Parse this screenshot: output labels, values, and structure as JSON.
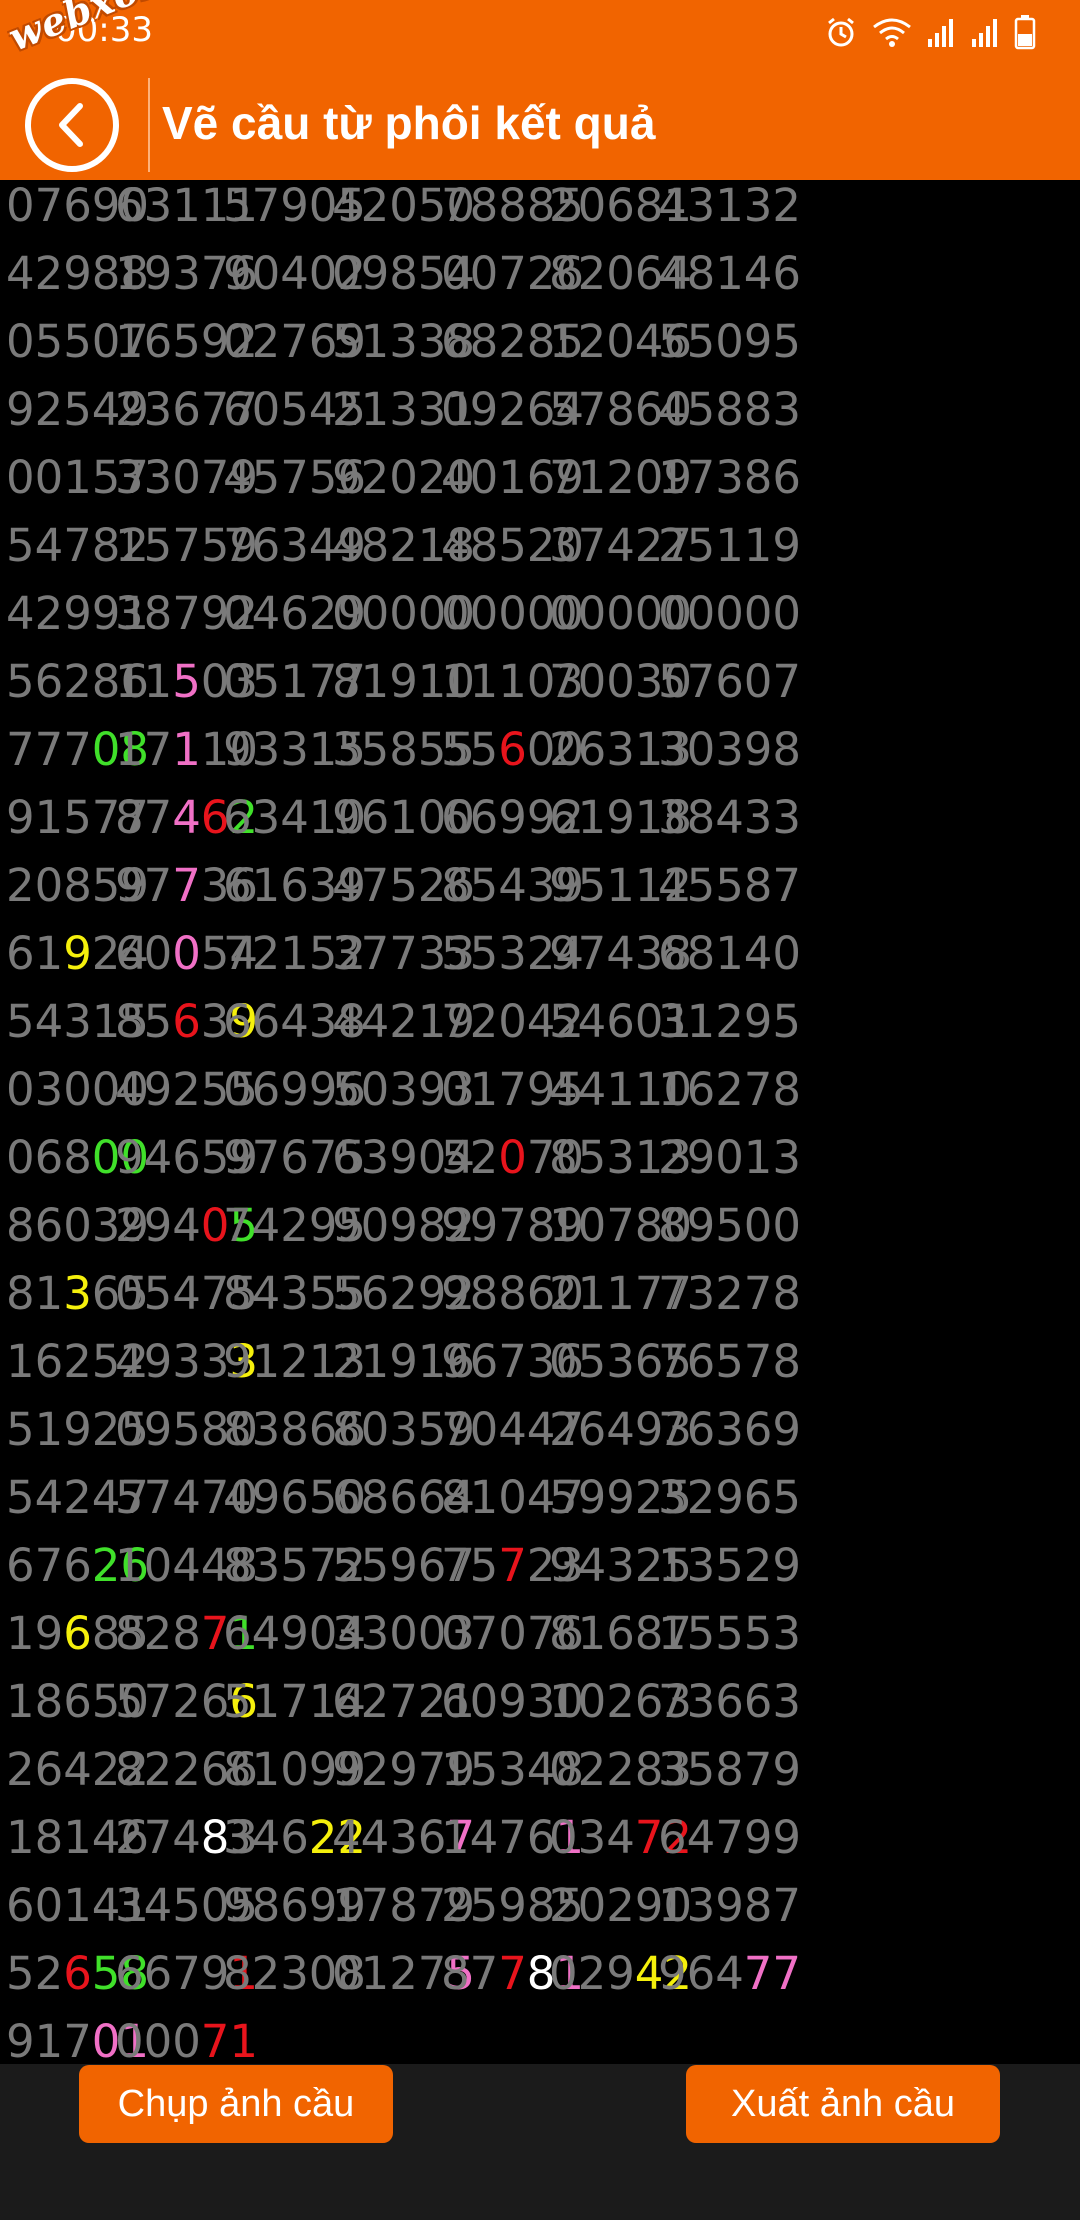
{
  "status_bar": {
    "time": "00:33",
    "watermark": "webxoso.net",
    "icons": [
      "alarm-icon",
      "wifi-icon",
      "signal-icon",
      "signal-icon",
      "battery-icon"
    ]
  },
  "header": {
    "title": "Vẽ cầu từ phôi kết quả",
    "back_icon": "chevron-left-icon"
  },
  "colors": {
    "header_bg": "#f16400",
    "default_digit": "#7a7a7a",
    "green": "#40e02a",
    "pink": "#f070c6",
    "red": "#e8141c",
    "yellow": "#f5f00c",
    "white": "#ffffff"
  },
  "grid": [
    [
      "07690",
      "63111",
      "57905",
      "42050",
      "78885",
      "20681",
      "43132"
    ],
    [
      "42988",
      "19376",
      "90402",
      "09854",
      "00726",
      "82064",
      "48146"
    ],
    [
      "05507",
      "16592",
      "02769",
      "51338",
      "68285",
      "12046",
      "55095"
    ],
    [
      "92549",
      "23677",
      "60545",
      "21331",
      "09264",
      "57860",
      "45883"
    ],
    [
      "00157",
      "33079",
      "45756",
      "92020",
      "40169",
      "71209",
      "17386"
    ],
    [
      "54782",
      "15759",
      "76349",
      "48218",
      "48520",
      "37427",
      "25119"
    ],
    [
      "42991",
      "38792",
      "04629",
      "00000",
      "00000",
      "00000",
      "00000"
    ],
    [
      "56286",
      "11503",
      "05177",
      "81910",
      "11103",
      "70030",
      "57607"
    ],
    [
      "77708",
      "17110",
      "93315",
      "35855",
      "55600",
      "26313",
      "30398"
    ],
    [
      "91577",
      "87462",
      "63410",
      "96100",
      "66992",
      "61918",
      "38433"
    ],
    [
      "20859",
      "97736",
      "61639",
      "47526",
      "85439",
      "95112",
      "45587"
    ],
    [
      "61924",
      "60054",
      "72152",
      "37733",
      "55324",
      "97438",
      "68140"
    ],
    [
      "54315",
      "85639",
      "66438",
      "44219",
      "72042",
      "54601",
      "31295"
    ],
    [
      "03000",
      "49255",
      "06996",
      "50393",
      "01795",
      "44110",
      "16278"
    ],
    [
      "06800",
      "94659",
      "97675",
      "63904",
      "52070",
      "85313",
      "29013"
    ],
    [
      "86039",
      "29405",
      "74295",
      "90982",
      "99789",
      "10780",
      "89500"
    ],
    [
      "81365",
      "05475",
      "84355",
      "56292",
      "98860",
      "21177",
      "73278"
    ],
    [
      "16252",
      "49333",
      "91213",
      "21916",
      "96736",
      "05365",
      "76578"
    ],
    [
      "51925",
      "09580",
      "83866",
      "80359",
      "70447",
      "26493",
      "76369"
    ],
    [
      "54247",
      "57470",
      "49650",
      "68664",
      "81047",
      "59925",
      "32965"
    ],
    [
      "67626",
      "10448",
      "83572",
      "55967",
      "75723",
      "94325",
      "13529"
    ],
    [
      "19685",
      "82871",
      "64904",
      "33003",
      "07076",
      "81687",
      "15553"
    ],
    [
      "18650",
      "57266",
      "51714",
      "62721",
      "60930",
      "10263",
      "73663"
    ],
    [
      "26422",
      "82266",
      "81099",
      "92979",
      "15348",
      "02283",
      "35879"
    ],
    [
      "18146",
      "27483",
      "34622",
      "44367",
      "14761",
      "03472",
      "64799"
    ],
    [
      "60141",
      "34505",
      "98699",
      "17879",
      "25985",
      "20290",
      "13987"
    ],
    [
      "52658",
      "66791",
      "82308",
      "01275",
      "87781",
      "02942",
      "96477"
    ],
    [
      "91701",
      "00071"
    ]
  ],
  "highlights": [
    {
      "row": 7,
      "col": 1,
      "pos": 2,
      "color": "pink"
    },
    {
      "row": 8,
      "col": 0,
      "pos": 3,
      "color": "green"
    },
    {
      "row": 8,
      "col": 0,
      "pos": 4,
      "color": "green"
    },
    {
      "row": 8,
      "col": 1,
      "pos": 2,
      "color": "pink"
    },
    {
      "row": 8,
      "col": 4,
      "pos": 2,
      "color": "red"
    },
    {
      "row": 9,
      "col": 1,
      "pos": 2,
      "color": "pink"
    },
    {
      "row": 9,
      "col": 1,
      "pos": 3,
      "color": "red"
    },
    {
      "row": 9,
      "col": 1,
      "pos": 4,
      "color": "green"
    },
    {
      "row": 10,
      "col": 1,
      "pos": 2,
      "color": "pink"
    },
    {
      "row": 11,
      "col": 0,
      "pos": 2,
      "color": "yellow"
    },
    {
      "row": 11,
      "col": 1,
      "pos": 2,
      "color": "pink"
    },
    {
      "row": 12,
      "col": 1,
      "pos": 2,
      "color": "red"
    },
    {
      "row": 12,
      "col": 1,
      "pos": 4,
      "color": "yellow"
    },
    {
      "row": 14,
      "col": 0,
      "pos": 3,
      "color": "green"
    },
    {
      "row": 14,
      "col": 0,
      "pos": 4,
      "color": "green"
    },
    {
      "row": 14,
      "col": 4,
      "pos": 2,
      "color": "red"
    },
    {
      "row": 15,
      "col": 1,
      "pos": 3,
      "color": "red"
    },
    {
      "row": 15,
      "col": 1,
      "pos": 4,
      "color": "green"
    },
    {
      "row": 16,
      "col": 0,
      "pos": 2,
      "color": "yellow"
    },
    {
      "row": 17,
      "col": 1,
      "pos": 4,
      "color": "yellow"
    },
    {
      "row": 20,
      "col": 0,
      "pos": 3,
      "color": "green"
    },
    {
      "row": 20,
      "col": 0,
      "pos": 4,
      "color": "green"
    },
    {
      "row": 20,
      "col": 4,
      "pos": 2,
      "color": "red"
    },
    {
      "row": 21,
      "col": 0,
      "pos": 2,
      "color": "yellow"
    },
    {
      "row": 21,
      "col": 1,
      "pos": 3,
      "color": "red"
    },
    {
      "row": 21,
      "col": 1,
      "pos": 4,
      "color": "green"
    },
    {
      "row": 22,
      "col": 1,
      "pos": 4,
      "color": "yellow"
    },
    {
      "row": 24,
      "col": 1,
      "pos": 3,
      "color": "white"
    },
    {
      "row": 24,
      "col": 2,
      "pos": 3,
      "color": "yellow"
    },
    {
      "row": 24,
      "col": 2,
      "pos": 4,
      "color": "yellow"
    },
    {
      "row": 24,
      "col": 3,
      "pos": 4,
      "color": "pink"
    },
    {
      "row": 24,
      "col": 4,
      "pos": 4,
      "color": "pink"
    },
    {
      "row": 24,
      "col": 5,
      "pos": 3,
      "color": "red"
    },
    {
      "row": 24,
      "col": 5,
      "pos": 4,
      "color": "red"
    },
    {
      "row": 26,
      "col": 0,
      "pos": 2,
      "color": "red"
    },
    {
      "row": 26,
      "col": 0,
      "pos": 3,
      "color": "green"
    },
    {
      "row": 26,
      "col": 0,
      "pos": 4,
      "color": "green"
    },
    {
      "row": 26,
      "col": 1,
      "pos": 4,
      "color": "red"
    },
    {
      "row": 26,
      "col": 3,
      "pos": 4,
      "color": "pink"
    },
    {
      "row": 26,
      "col": 4,
      "pos": 2,
      "color": "red"
    },
    {
      "row": 26,
      "col": 4,
      "pos": 3,
      "color": "white"
    },
    {
      "row": 26,
      "col": 4,
      "pos": 4,
      "color": "pink"
    },
    {
      "row": 26,
      "col": 5,
      "pos": 3,
      "color": "yellow"
    },
    {
      "row": 26,
      "col": 5,
      "pos": 4,
      "color": "yellow"
    },
    {
      "row": 26,
      "col": 6,
      "pos": 3,
      "color": "pink"
    },
    {
      "row": 26,
      "col": 6,
      "pos": 4,
      "color": "pink"
    },
    {
      "row": 27,
      "col": 0,
      "pos": 3,
      "color": "pink"
    },
    {
      "row": 27,
      "col": 0,
      "pos": 4,
      "color": "pink"
    },
    {
      "row": 27,
      "col": 1,
      "pos": 3,
      "color": "red"
    },
    {
      "row": 27,
      "col": 1,
      "pos": 4,
      "color": "red"
    }
  ],
  "buttons": {
    "capture": "Chụp ảnh cầu",
    "export": "Xuất ảnh cầu"
  }
}
